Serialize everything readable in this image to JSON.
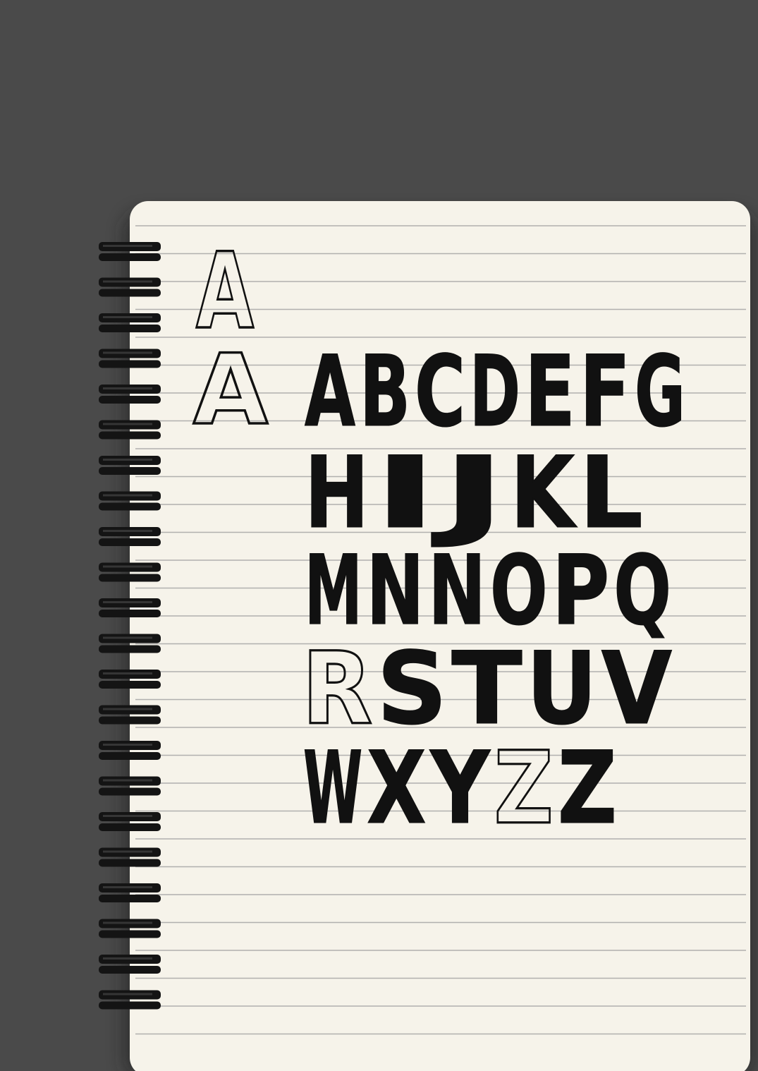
{
  "photo": {
    "subject": "spiral notebook page with hand-drawn block alphabet",
    "colors": {
      "background": "#4a4a4a",
      "paper": "#f6f3ea",
      "rule_line": "#9a9a9a",
      "ink": "#111111",
      "spiral": "#141414"
    },
    "sample_glyphs": [
      "A",
      "A"
    ],
    "alphabet_rows": [
      "ABCDEFG",
      "HIJKL",
      "MNNOPQ",
      "RSTUV",
      "WXYZZ"
    ],
    "outlined_letters": [
      [
        3,
        0
      ],
      [
        4,
        3
      ]
    ],
    "ring_count": 22,
    "rule_count": 30
  }
}
